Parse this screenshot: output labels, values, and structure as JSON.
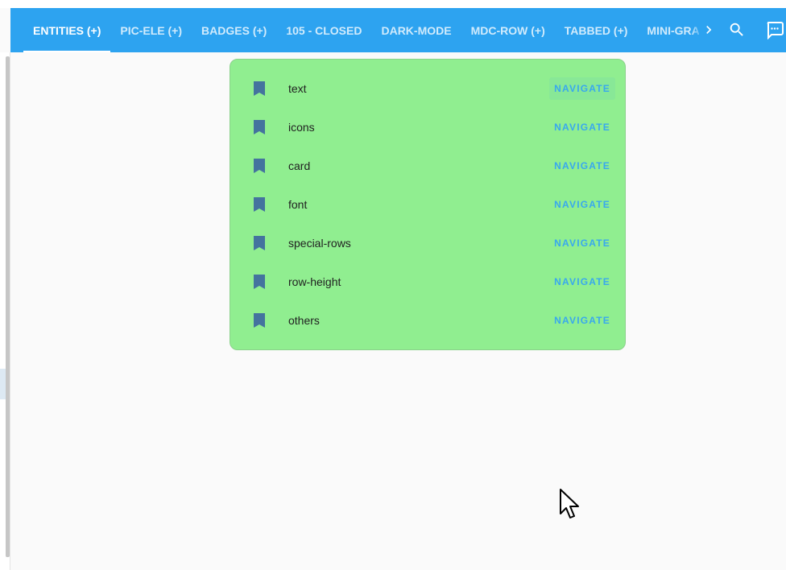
{
  "header": {
    "tabs": [
      {
        "label": "ENTITIES (+)",
        "active": true
      },
      {
        "label": "PIC-ELE (+)",
        "active": false
      },
      {
        "label": "BADGES (+)",
        "active": false
      },
      {
        "label": "105 - CLOSED",
        "active": false
      },
      {
        "label": "DARK-MODE",
        "active": false
      },
      {
        "label": "MDC-ROW (+)",
        "active": false
      },
      {
        "label": "TABBED (+)",
        "active": false
      },
      {
        "label": "MINI-GRAPH",
        "active": false
      }
    ],
    "icons": {
      "next": "chevron-right-icon",
      "search": "search-icon",
      "chat": "chat-icon"
    }
  },
  "card": {
    "rows": [
      {
        "label": "text",
        "action": "NAVIGATE"
      },
      {
        "label": "icons",
        "action": "NAVIGATE"
      },
      {
        "label": "card",
        "action": "NAVIGATE"
      },
      {
        "label": "font",
        "action": "NAVIGATE"
      },
      {
        "label": "special-rows",
        "action": "NAVIGATE"
      },
      {
        "label": "row-height",
        "action": "NAVIGATE"
      },
      {
        "label": "others",
        "action": "NAVIGATE"
      }
    ],
    "row_icon": "bookmark-icon"
  },
  "colors": {
    "header": "#2da3f0",
    "card": "#90ee90",
    "accent": "#38a8ee",
    "icon": "#44739e"
  }
}
